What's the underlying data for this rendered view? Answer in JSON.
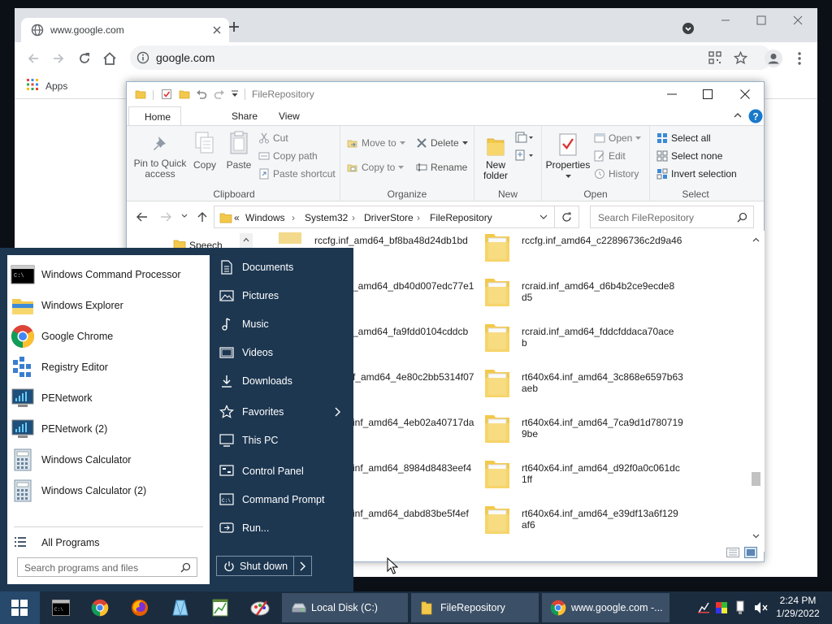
{
  "browser": {
    "tab_title": "www.google.com",
    "url": "google.com",
    "bookmarks_apps": "Apps"
  },
  "explorer": {
    "title": "FileRepository",
    "tabs": [
      "Home",
      "Share",
      "View"
    ],
    "clipboard": {
      "pin": "Pin to Quick access",
      "pin_l1": "Pin to Quick",
      "pin_l2": "access",
      "copy": "Copy",
      "paste": "Paste",
      "cut": "Cut",
      "copy_path": "Copy path",
      "paste_shortcut": "Paste shortcut",
      "label": "Clipboard"
    },
    "organize": {
      "move_to": "Move to",
      "copy_to": "Copy to",
      "delete": "Delete",
      "rename": "Rename",
      "label": "Organize"
    },
    "new": {
      "new_folder_l1": "New",
      "new_folder_l2": "folder",
      "label": "New"
    },
    "open": {
      "properties": "Properties",
      "open": "Open",
      "edit": "Edit",
      "history": "History",
      "label": "Open"
    },
    "select": {
      "select_all": "Select all",
      "select_none": "Select none",
      "invert": "Invert selection",
      "label": "Select"
    },
    "breadcrumb": [
      "Windows",
      "System32",
      "DriverStore",
      "FileRepository"
    ],
    "breadcrumb_prefix": "«",
    "search_placeholder": "Search FileRepository",
    "nav_item": "Speech",
    "files_left": [
      "rccfg.inf_amd64_bf8ba48d24db1bd",
      "_amd64_db40d007edc77e1",
      "_amd64_fa9fdd0104cddcb",
      "f_amd64_4e80c2bb5314f07",
      "inf_amd64_4eb02a40717da",
      "inf_amd64_8984d8483eef4",
      "inf_amd64_dabd83be5f4ef"
    ],
    "files_right": [
      {
        "l1": "rccfg.inf_amd64_c22896736c2d9a46",
        "l2": ""
      },
      {
        "l1": "rcraid.inf_amd64_d6b4b2ce9ecde8",
        "l2": "d5"
      },
      {
        "l1": "rcraid.inf_amd64_fddcfddaca70ace",
        "l2": "b"
      },
      {
        "l1": "rt640x64.inf_amd64_3c868e6597b63",
        "l2": "aeb"
      },
      {
        "l1": "rt640x64.inf_amd64_7ca9d1d780719",
        "l2": "9be"
      },
      {
        "l1": "rt640x64.inf_amd64_d92f0a0c061dc",
        "l2": "1ff"
      },
      {
        "l1": "rt640x64.inf_amd64_e39df13a6f129",
        "l2": "af6"
      }
    ]
  },
  "start_menu": {
    "programs": [
      {
        "name": "Windows Command Processor",
        "icon": "cmd-icon"
      },
      {
        "name": "Windows Explorer",
        "icon": "explorer-icon"
      },
      {
        "name": "Google Chrome",
        "icon": "chrome-icon"
      },
      {
        "name": "Registry Editor",
        "icon": "registry-icon"
      },
      {
        "name": "PENetwork",
        "icon": "network-icon"
      },
      {
        "name": "PENetwork (2)",
        "icon": "network-icon"
      },
      {
        "name": "Windows Calculator",
        "icon": "calculator-icon"
      },
      {
        "name": "Windows Calculator (2)",
        "icon": "calculator-icon"
      }
    ],
    "all_programs": "All Programs",
    "search_placeholder": "Search programs and files",
    "places": [
      "Documents",
      "Pictures",
      "Music",
      "Videos",
      "Downloads",
      "Favorites",
      "This PC",
      "Control Panel",
      "Command Prompt",
      "Run..."
    ],
    "shutdown": "Shut down"
  },
  "taskbar": {
    "buttons": [
      "Local Disk (C:)",
      "FileRepository",
      "www.google.com -..."
    ],
    "time": "2:24 PM",
    "date": "1/29/2022"
  },
  "colors": {
    "start_menu_bg": "#1d3751",
    "taskbar_bg": "#1b2c3f",
    "accent": "#1a73e8",
    "folder_yellow": "#f3c94b"
  }
}
